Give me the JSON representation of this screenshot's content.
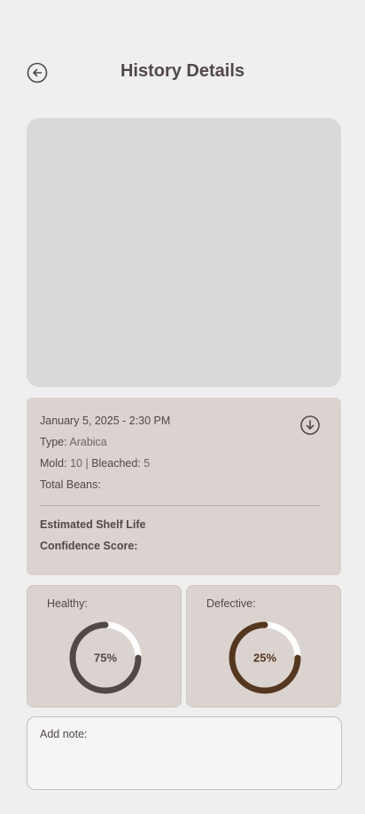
{
  "header": {
    "title": "History Details"
  },
  "details": {
    "datetime": "January 5, 2025 - 2:30 PM",
    "type_label": "Type:",
    "type_value": "Arabica",
    "mold_label": "Mold:",
    "mold_value": "10",
    "separator": "|",
    "bleached_label": "Bleached:",
    "bleached_value": "5",
    "total_beans_label": "Total Beans:",
    "shelf_life_label": "Estimated Shelf Life",
    "confidence_label": "Confidence Score:"
  },
  "stats": {
    "healthy": {
      "label": "Healthy:",
      "percent_text": "75%",
      "fraction": 0.75,
      "color": "#524848",
      "text_color": "#524848"
    },
    "defective": {
      "label": "Defective:",
      "percent_text": "25%",
      "fraction": 0.75,
      "color": "#55361f",
      "text_color": "#55361f"
    }
  },
  "note": {
    "placeholder": "Add note:"
  },
  "icons": {
    "back": "arrow-left-circle-icon",
    "download": "arrow-down-circle-icon"
  },
  "colors": {
    "background": "#efefef",
    "card": "#dbd3cf",
    "image_placeholder": "#d9d9d9",
    "text": "#524848",
    "ring_track": "#ffffff"
  }
}
